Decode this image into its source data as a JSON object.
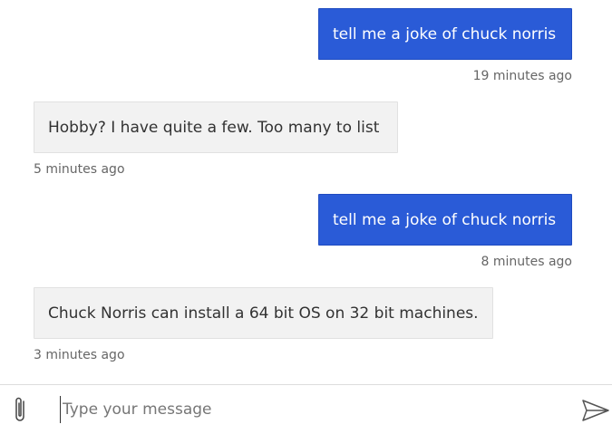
{
  "transcript": {
    "messages": [
      {
        "role": "user",
        "text": "tell me a joke of chuck norris",
        "timestamp": "19 minutes ago"
      },
      {
        "role": "bot",
        "text": "Hobby? I have quite a few. Too many to list",
        "timestamp": "5 minutes ago"
      },
      {
        "role": "user",
        "text": "tell me a joke of chuck norris",
        "timestamp": "8 minutes ago"
      },
      {
        "role": "bot",
        "text": "Chuck Norris can install a 64 bit OS on 32 bit machines.",
        "timestamp": "3 minutes ago"
      }
    ]
  },
  "composer": {
    "placeholder": "Type your message",
    "value": "",
    "attach_icon": "paperclip-icon",
    "send_icon": "send-icon"
  },
  "colors": {
    "user_bubble": "#2a5bd7",
    "bot_bubble": "#f2f2f2",
    "timestamp": "#666666"
  }
}
